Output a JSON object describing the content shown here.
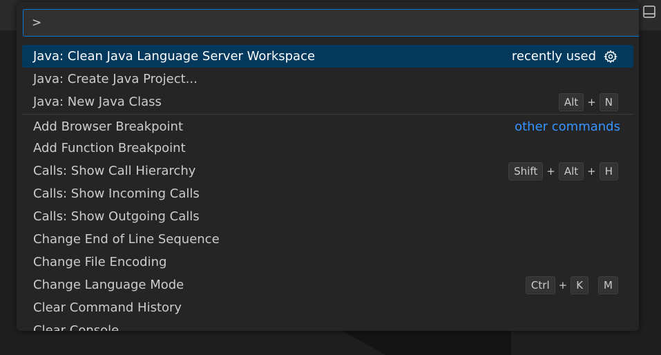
{
  "input": {
    "value": ">"
  },
  "commands": [
    {
      "label": "Java: Clean Java Language Server Workspace",
      "right_text": "recently used",
      "selected": true
    },
    {
      "label": "Java: Create Java Project..."
    },
    {
      "label": "Java: New Java Class",
      "keys": [
        "Alt",
        "N"
      ]
    },
    {
      "label": "Add Browser Breakpoint",
      "group": "other commands"
    },
    {
      "label": "Add Function Breakpoint"
    },
    {
      "label": "Calls: Show Call Hierarchy",
      "keys": [
        "Shift",
        "Alt",
        "H"
      ]
    },
    {
      "label": "Calls: Show Incoming Calls"
    },
    {
      "label": "Calls: Show Outgoing Calls"
    },
    {
      "label": "Change End of Line Sequence"
    },
    {
      "label": "Change File Encoding"
    },
    {
      "label": "Change Language Mode",
      "keys": [
        "Ctrl",
        "K"
      ],
      "chord": [
        "M"
      ]
    },
    {
      "label": "Clear Command History"
    },
    {
      "label": "Clear Console"
    }
  ],
  "colors": {
    "accent": "#0078d4",
    "selection": "#04395e",
    "group_label": "#3794ff"
  },
  "icons": {
    "configure": "gear-icon",
    "panel": "toggle-panel-icon"
  }
}
